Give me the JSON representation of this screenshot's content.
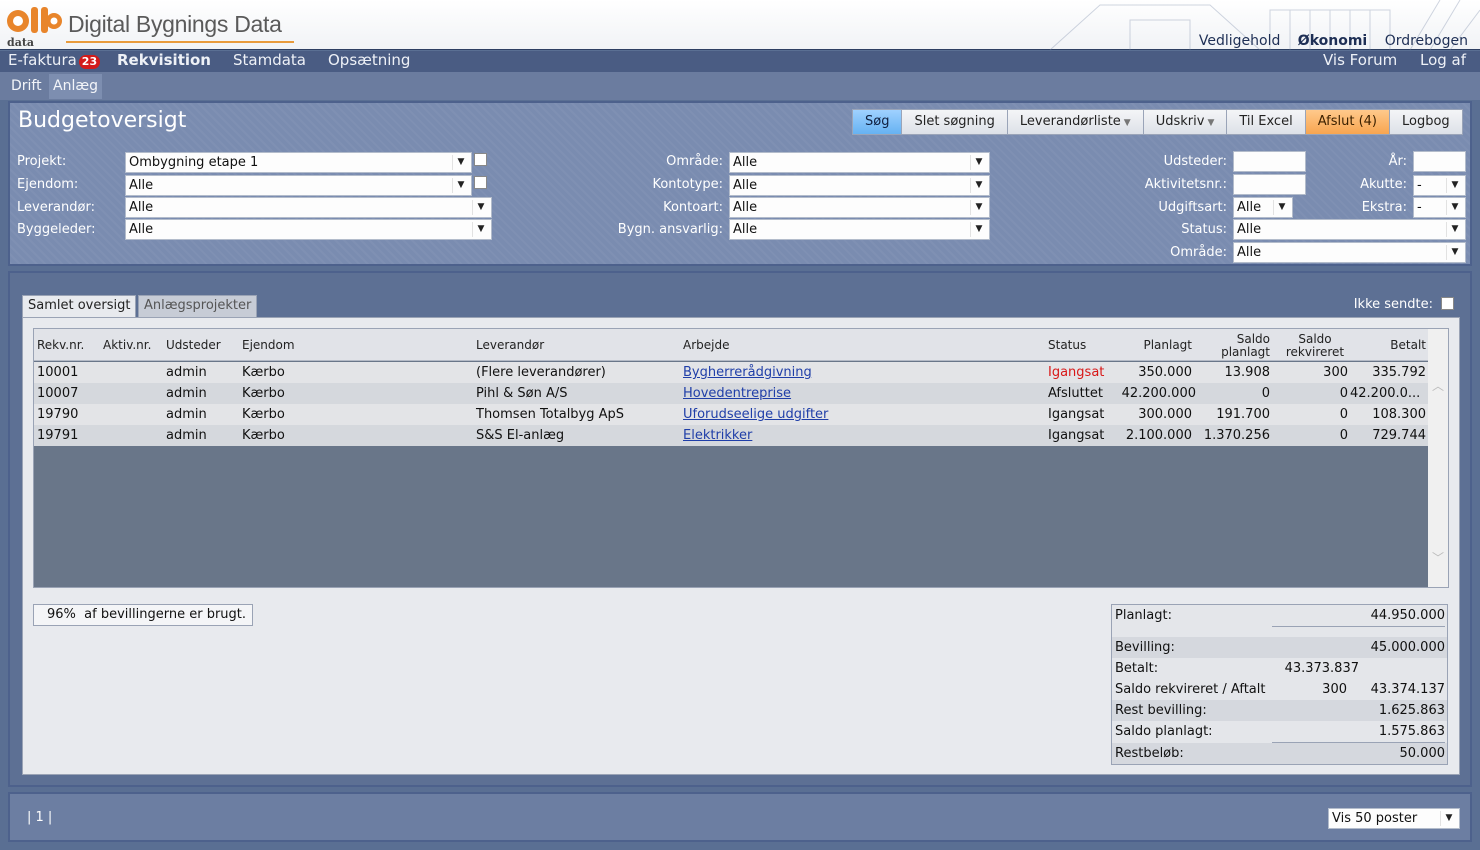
{
  "app": {
    "logo_text": "Digital Bygnings Data",
    "logo_mark_text": "data"
  },
  "top_links": [
    "Vedligehold",
    "Økonomi",
    "Ordrebogen"
  ],
  "main_nav": {
    "efaktura": "E-faktura",
    "efaktura_badge": "23",
    "rekvisition": "Rekvisition",
    "stamdata": "Stamdata",
    "opsaetning": "Opsætning",
    "vis_forum": "Vis Forum",
    "log_af": "Log af"
  },
  "sub_nav": {
    "drift": "Drift",
    "anlaeg": "Anlæg"
  },
  "page": {
    "title": "Budgetoversigt"
  },
  "toolbar": {
    "sog": "Søg",
    "slet_sogning": "Slet søgning",
    "leverandorliste": "Leverandørliste",
    "udskriv": "Udskriv",
    "til_excel": "Til Excel",
    "afslut": "Afslut (4)",
    "logbog": "Logbog"
  },
  "filters": {
    "projekt": {
      "label": "Projekt:",
      "value": "Ombygning etape 1"
    },
    "ejendom": {
      "label": "Ejendom:",
      "value": "Alle"
    },
    "leverandor": {
      "label": "Leverandør:",
      "value": "Alle"
    },
    "byggeleder": {
      "label": "Byggeleder:",
      "value": "Alle"
    },
    "omraade": {
      "label": "Område:",
      "value": "Alle"
    },
    "kontotype": {
      "label": "Kontotype:",
      "value": "Alle"
    },
    "kontoart": {
      "label": "Kontoart:",
      "value": "Alle"
    },
    "bygn_ansvarlig": {
      "label": "Bygn. ansvarlig:",
      "value": "Alle"
    },
    "udsteder": {
      "label": "Udsteder:",
      "value": ""
    },
    "aktivitetsnr": {
      "label": "Aktivitetsnr.:",
      "value": ""
    },
    "udgiftsart": {
      "label": "Udgiftsart:",
      "value": "Alle"
    },
    "status": {
      "label": "Status:",
      "value": "Alle"
    },
    "omraade2": {
      "label": "Område:",
      "value": "Alle"
    },
    "aar": {
      "label": "År:",
      "value": ""
    },
    "akutte": {
      "label": "Akutte:",
      "value": "-"
    },
    "ekstra": {
      "label": "Ekstra:",
      "value": "-"
    }
  },
  "content_tabs": {
    "samlet": "Samlet oversigt",
    "anlaeg": "Anlægsprojekter"
  },
  "ikke_sendte": "Ikke sendte:",
  "table": {
    "headers": {
      "rekv": "Rekv.nr.",
      "aktiv": "Aktiv.nr.",
      "udsteder": "Udsteder",
      "ejendom": "Ejendom",
      "leverandor": "Leverandør",
      "arbejde": "Arbejde",
      "status": "Status",
      "planlagt": "Planlagt",
      "saldo_planlagt_1": "Saldo",
      "saldo_planlagt_2": "planlagt",
      "saldo_rekv_1": "Saldo",
      "saldo_rekv_2": "rekvireret",
      "betalt": "Betalt"
    },
    "rows": [
      {
        "rekv": "10001",
        "aktiv": "",
        "udsteder": "admin",
        "ejendom": "Kærbo",
        "leverandor": "(Flere leverandører)",
        "arbejde": "Bygherrerådgivning",
        "status": "Igangsat",
        "planlagt": "350.000",
        "saldo_planlagt": "13.908",
        "saldo_rekv": "300",
        "betalt": "335.792"
      },
      {
        "rekv": "10007",
        "aktiv": "",
        "udsteder": "admin",
        "ejendom": "Kærbo",
        "leverandor": "Pihl & Søn A/S",
        "arbejde": "Hovedentreprise",
        "status": "Afsluttet",
        "planlagt": "42.200.000",
        "saldo_planlagt": "0",
        "saldo_rekv": "0",
        "betalt": "42.200.0..."
      },
      {
        "rekv": "19790",
        "aktiv": "",
        "udsteder": "admin",
        "ejendom": "Kærbo",
        "leverandor": "Thomsen Totalbyg ApS",
        "arbejde": "Uforudseelige udgifter",
        "status": "Igangsat",
        "planlagt": "300.000",
        "saldo_planlagt": "191.700",
        "saldo_rekv": "0",
        "betalt": "108.300"
      },
      {
        "rekv": "19791",
        "aktiv": "",
        "udsteder": "admin",
        "ejendom": "Kærbo",
        "leverandor": "S&S El-anlæg",
        "arbejde": "Elektrikker",
        "status": "Igangsat",
        "planlagt": "2.100.000",
        "saldo_planlagt": "1.370.256",
        "saldo_rekv": "0",
        "betalt": "729.744"
      }
    ],
    "status_colors": {
      "igangsat_first": "#d81818"
    }
  },
  "summary_pct": {
    "pct": "96%",
    "text": "af bevillingerne er brugt."
  },
  "summary": {
    "planlagt_label": "Planlagt:",
    "planlagt": "44.950.000",
    "bevilling_label": "Bevilling:",
    "bevilling": "45.000.000",
    "betalt_label": "Betalt:",
    "betalt": "43.373.837",
    "saldo_label": "Saldo rekvireret / Aftalt",
    "saldo_rekv": "300",
    "aftalt": "43.374.137",
    "rest_label": "Rest bevilling:",
    "rest": "1.625.863",
    "saldo_planlagt_label": "Saldo planlagt:",
    "saldo_planlagt": "1.575.863",
    "restbelob_label": "Restbeløb:",
    "restbelob": "50.000"
  },
  "footer": {
    "pager": "| 1 |",
    "vis_poster": "Vis 50 poster"
  }
}
